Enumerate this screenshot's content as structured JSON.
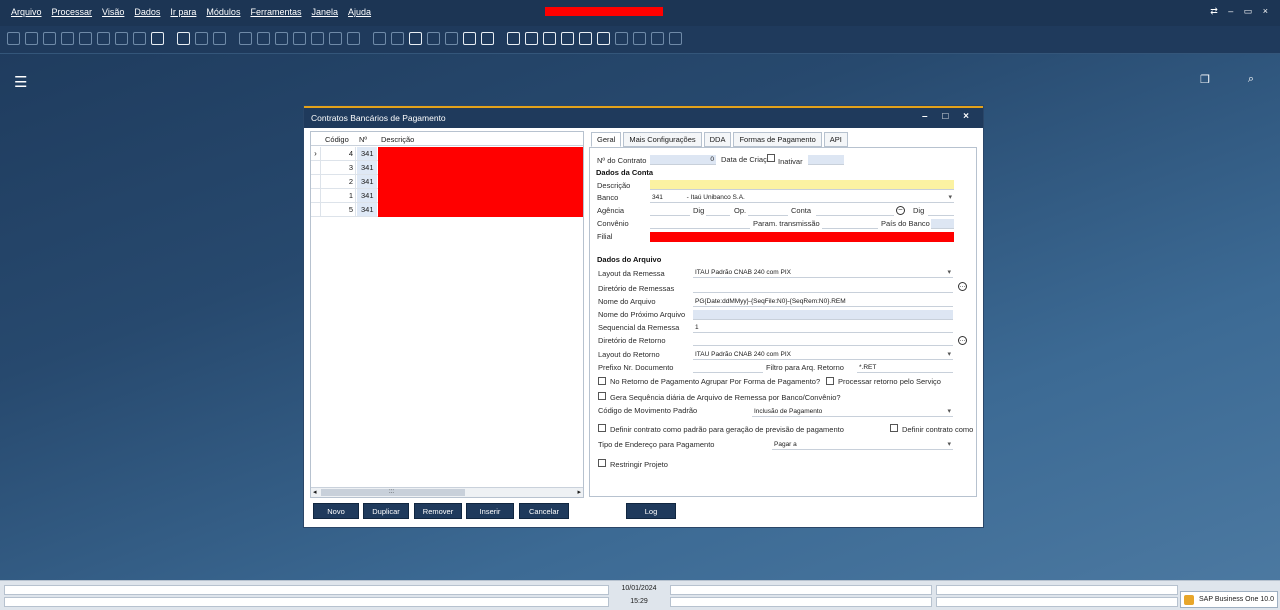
{
  "menu": [
    "Arquivo",
    "Processar",
    "Visão",
    "Dados",
    "Ir para",
    "Módulos",
    "Ferramentas",
    "Janela",
    "Ajuda"
  ],
  "window_controls": "⇄ – ▭ ×",
  "icons": {
    "hamburger": "☰",
    "window": "❐",
    "search": "⌕"
  },
  "dialog": {
    "title": "Contratos Bancários de Pagamento",
    "controls": "– □ ×",
    "grid": {
      "columns": [
        "Código",
        "Nº",
        "Descrição"
      ],
      "rows": [
        {
          "cod": "4",
          "num": "341",
          "selected": true
        },
        {
          "cod": "3",
          "num": "341"
        },
        {
          "cod": "2",
          "num": "341"
        },
        {
          "cod": "1",
          "num": "341"
        },
        {
          "cod": "5",
          "num": "341"
        }
      ],
      "scroll_mid": ":::"
    },
    "tabs": [
      "Geral",
      "Mais Configurações",
      "DDA",
      "Formas de Pagamento",
      "API"
    ],
    "geral": {
      "nro_contrato_label": "Nº do Contrato",
      "nro_contrato_value": "0",
      "data_criacao_label": "Data de Criaç",
      "inativar_label": "Inativar",
      "dados_conta": "Dados da Conta",
      "descricao_label": "Descrição",
      "banco_label": "Banco",
      "banco_code": "341",
      "banco_name": "- Itaú Unibanco  S.A.",
      "agencia_label": "Agência",
      "dig1_label": "Dig",
      "op_label": "Op.",
      "conta_label": "Conta",
      "dig2_label": "Dig",
      "convenio_label": "Convênio",
      "param_label": "Param. transmissão",
      "pais_label": "País do Banco",
      "filial_label": "Filial",
      "dados_arquivo": "Dados do Arquivo",
      "layout_remessa_label": "Layout da Remessa",
      "layout_remessa_value": "ITAU Padrão CNAB 240 com PIX",
      "dir_remessas_label": "Diretório de Remessas",
      "nome_arquivo_label": "Nome do Arquivo",
      "nome_arquivo_value": "PG{Date:ddMMyy}-{SeqFile:N0}-{SeqRem:N0}.REM",
      "nome_proximo_label": "Nome do Próximo Arquivo",
      "sequencial_label": "Sequencial da Remessa",
      "sequencial_value": "1",
      "dir_retorno_label": "Diretório de Retorno",
      "layout_retorno_label": "Layout do Retorno",
      "layout_retorno_value": "ITAU Padrão CNAB 240 com PIX",
      "prefixo_label": "Prefixo Nr. Documento",
      "filtro_label": "Filtro para Arq. Retorno",
      "filtro_value": "*.RET",
      "cb_agrupar": "No Retorno de Pagamento Agrupar Por Forma de Pagamento?",
      "cb_servico": "Processar retorno pelo Serviço",
      "cb_sequencia": "Gera Sequência diária de Arquivo de Remessa  por Banco/Convênio?",
      "cod_mov_label": "Código de Movimento Padrão",
      "cod_mov_value": "Inclusão de Pagamento",
      "cb_padrao_prev": "Definir contrato como padrão para geração de previsão de pagamento",
      "cb_padrao2": "Definir contrato como",
      "tipo_end_label": "Tipo de Endereço para Pagamento",
      "tipo_end_value": "Pagar a",
      "cb_restringir": "Restringir Projeto"
    },
    "buttons": [
      "Novo",
      "Duplicar",
      "Remover",
      "Inserir",
      "Cancelar",
      "Log"
    ]
  },
  "status": {
    "date": "10/01/2024",
    "time": "15:29",
    "sap": "SAP Business One 10.0"
  },
  "colors": {
    "accent": "#e3a21a",
    "primary": "#1f3a5c",
    "redacted": "#ff0000"
  }
}
